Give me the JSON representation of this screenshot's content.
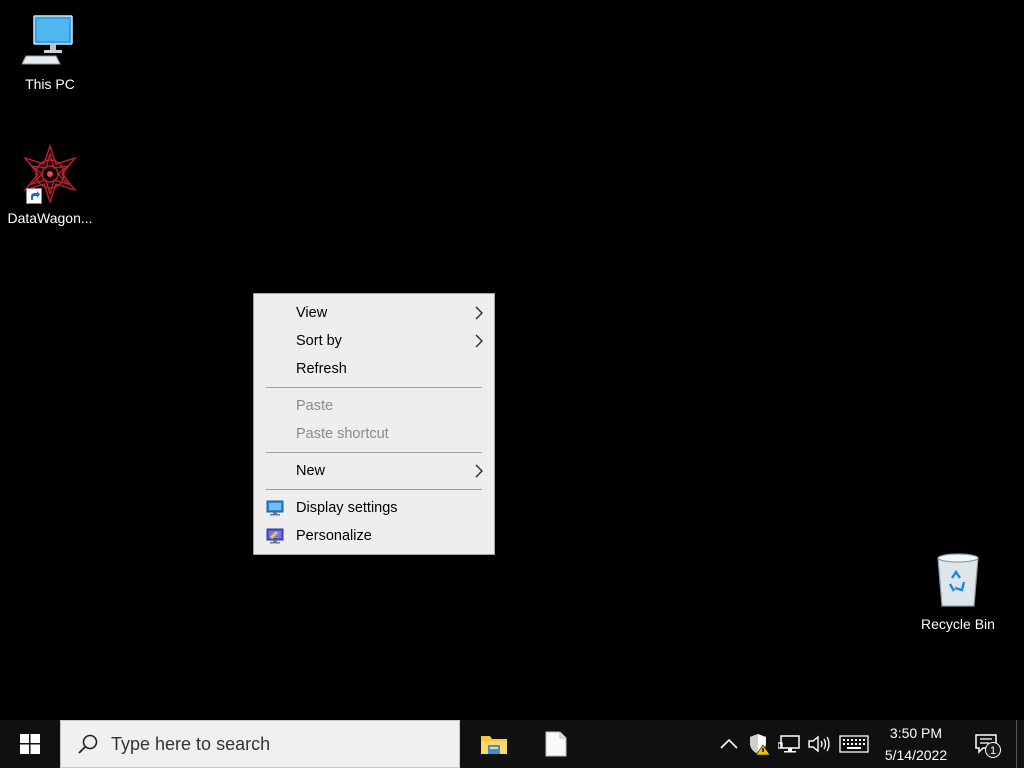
{
  "desktop": {
    "icons": [
      {
        "label": "This PC",
        "icon": "computer-icon"
      },
      {
        "label": "DataWagon...",
        "icon": "datawagon-shortcut-icon"
      },
      {
        "label": "Recycle Bin",
        "icon": "recycle-bin-icon"
      }
    ]
  },
  "context_menu": {
    "items": [
      {
        "label": "View",
        "has_submenu": true,
        "enabled": true
      },
      {
        "label": "Sort by",
        "has_submenu": true,
        "enabled": true
      },
      {
        "label": "Refresh",
        "has_submenu": false,
        "enabled": true
      },
      {
        "label": "Paste",
        "has_submenu": false,
        "enabled": false
      },
      {
        "label": "Paste shortcut",
        "has_submenu": false,
        "enabled": false
      },
      {
        "label": "New",
        "has_submenu": true,
        "enabled": true
      },
      {
        "label": "Display settings",
        "icon": "display-settings-icon",
        "enabled": true
      },
      {
        "label": "Personalize",
        "icon": "personalize-icon",
        "enabled": true
      }
    ]
  },
  "taskbar": {
    "search_placeholder": "Type here to search",
    "apps": [
      {
        "icon": "file-explorer-icon"
      },
      {
        "icon": "document-icon"
      }
    ],
    "tray": {
      "icons": [
        "chevron-up-icon",
        "security-warning-icon",
        "network-icon",
        "volume-icon",
        "keyboard-icon"
      ]
    },
    "clock": {
      "time": "3:50 PM",
      "date": "5/14/2022"
    },
    "notification_count": "1"
  },
  "colors": {
    "desktop_bg": "#000000",
    "menu_bg": "#eeeeee",
    "taskbar_bg": "#101010",
    "search_bg": "#f0f0f0",
    "disabled_text": "#8a8a8a"
  }
}
